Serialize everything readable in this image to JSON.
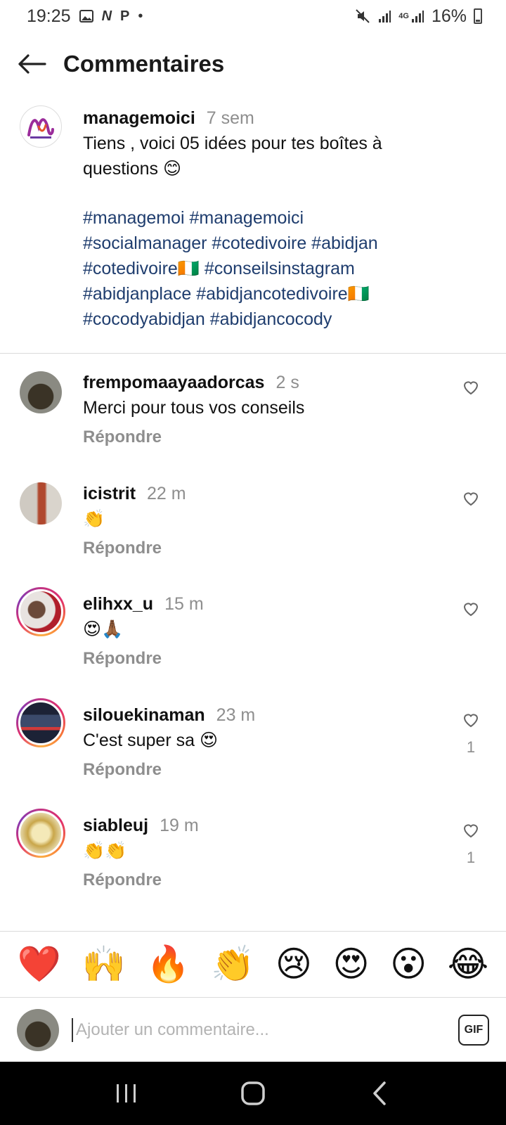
{
  "status_bar": {
    "time": "19:25",
    "left_icons": [
      "image-icon",
      "n-icon",
      "p-icon",
      "dot-icon"
    ],
    "right_icons": [
      "mute-icon",
      "signal-icon",
      "4g-signal-icon"
    ],
    "network": "4G",
    "battery": "16%"
  },
  "header": {
    "title": "Commentaires"
  },
  "caption": {
    "username": "managemoici",
    "time": "7 sem",
    "text": "Tiens , voici 05 idées pour tes boîtes à questions 😊",
    "hashtags": [
      "#managemoi #managemoici",
      "#socialmanager #cotedivoire #abidjan",
      "#cotedivoire🇨🇮 #conseilsinstagram",
      "#abidjanplace #abidjancotedivoire🇨🇮",
      "#cocodyabidjan #abidjancocody"
    ]
  },
  "comments": [
    {
      "username": "frempomaayaadorcas",
      "time": "2 s",
      "text": "Merci pour tous vos conseils",
      "reply": "Répondre",
      "likes": ""
    },
    {
      "username": "icistrit",
      "time": "22 m",
      "text": "👏",
      "reply": "Répondre",
      "likes": ""
    },
    {
      "username": "elihxx_u",
      "time": "15 m",
      "text": "😍🙏🏾",
      "reply": "Répondre",
      "likes": ""
    },
    {
      "username": "silouekinaman",
      "time": "23 m",
      "text": "C'est super sa 😍",
      "reply": "Répondre",
      "likes": "1"
    },
    {
      "username": "siableuj",
      "time": "19 m",
      "text": "👏👏",
      "reply": "Répondre",
      "likes": "1"
    }
  ],
  "emoji_bar": [
    "❤️",
    "🙌",
    "🔥",
    "👏",
    "😢",
    "😍",
    "😮",
    "😂"
  ],
  "composer": {
    "placeholder": "Ajouter un commentaire...",
    "gif_label": "GIF"
  },
  "colors": {
    "hashtag": "#1f3d6e",
    "muted": "#8e8e8e",
    "divider": "#dbdbdb"
  }
}
